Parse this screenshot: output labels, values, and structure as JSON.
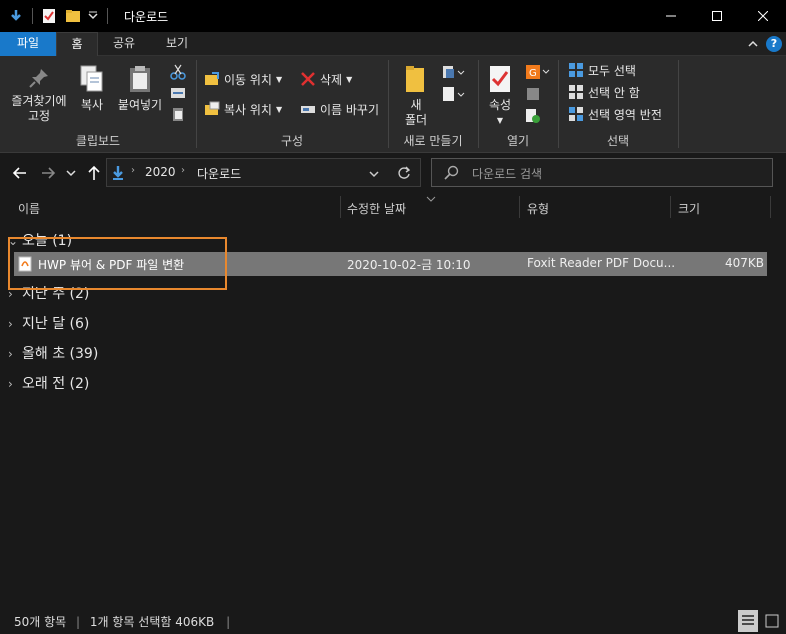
{
  "window": {
    "title": "다운로드",
    "minimize": "—",
    "maximize": "☐",
    "close": "✕"
  },
  "tabs": [
    "파일",
    "홈",
    "공유",
    "보기"
  ],
  "ribbon": {
    "clipboard": {
      "pin_label_1": "즐겨찾기에",
      "pin_label_2": "고정",
      "copy": "복사",
      "paste": "붙여넣기",
      "group": "클립보드"
    },
    "organize": {
      "move_to": "이동 위치",
      "copy_to": "복사 위치",
      "delete": "삭제",
      "rename": "이름 바꾸기",
      "group": "구성"
    },
    "new": {
      "folder_1": "새",
      "folder_2": "폴더",
      "group": "새로 만들기"
    },
    "open": {
      "properties": "속성",
      "group": "열기"
    },
    "select": {
      "select_all": "모두 선택",
      "select_none": "선택 안 함",
      "invert": "선택 영역 반전",
      "group": "선택"
    }
  },
  "address": {
    "crumbs": [
      "2020",
      "다운로드"
    ],
    "search_placeholder": "다운로드 검색"
  },
  "columns": [
    "이름",
    "수정한 날짜",
    "유형",
    "크기"
  ],
  "groups": [
    {
      "label": "오늘 (1)",
      "expanded": true
    },
    {
      "label": "지난 주 (2)",
      "expanded": false
    },
    {
      "label": "지난 달 (6)",
      "expanded": false
    },
    {
      "label": "올해 초 (39)",
      "expanded": false
    },
    {
      "label": "오래 전 (2)",
      "expanded": false
    }
  ],
  "files": [
    {
      "name": "HWP 뷰어 & PDF 파일 변환",
      "modified": "2020-10-02-금 10:10",
      "type": "Foxit Reader PDF Docu...",
      "size": "407KB"
    }
  ],
  "status": {
    "count": "50개 항목",
    "selected": "1개 항목 선택함 406KB"
  },
  "colors": {
    "accent": "#1979ca",
    "highlight_border": "#e8882e"
  }
}
